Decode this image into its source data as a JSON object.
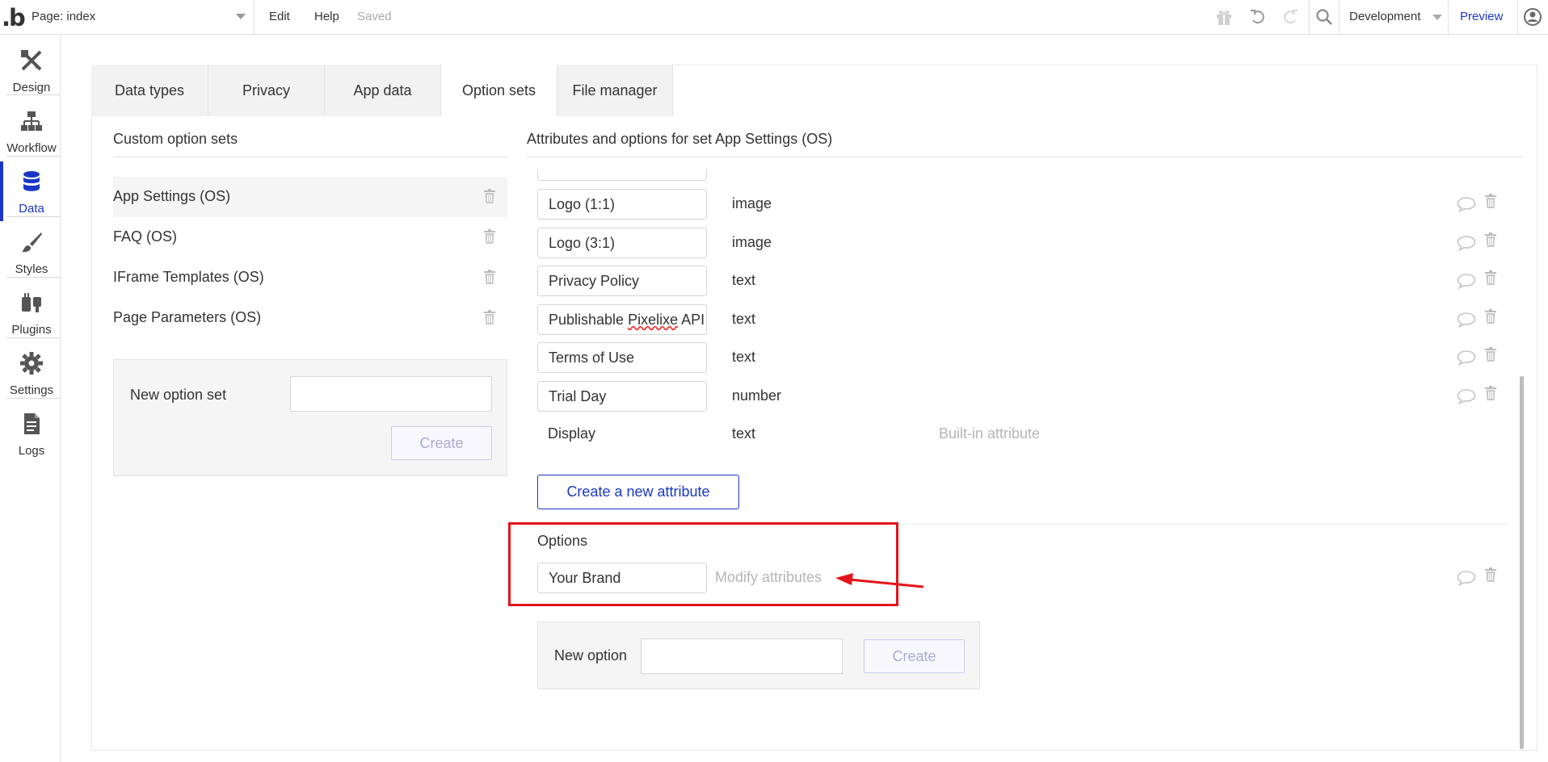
{
  "topbar": {
    "page_label": "Page: index",
    "menu_edit": "Edit",
    "menu_help": "Help",
    "status": "Saved",
    "environment": "Development",
    "preview": "Preview"
  },
  "sidebar": {
    "items": [
      {
        "label": "Design",
        "icon": "design-icon"
      },
      {
        "label": "Workflow",
        "icon": "workflow-icon"
      },
      {
        "label": "Data",
        "icon": "database-icon"
      },
      {
        "label": "Styles",
        "icon": "brush-icon"
      },
      {
        "label": "Plugins",
        "icon": "plug-icon"
      },
      {
        "label": "Settings",
        "icon": "gear-icon"
      },
      {
        "label": "Logs",
        "icon": "document-icon"
      }
    ],
    "active": "Data"
  },
  "tabs": [
    {
      "label": "Data types"
    },
    {
      "label": "Privacy"
    },
    {
      "label": "App data"
    },
    {
      "label": "Option sets"
    },
    {
      "label": "File manager"
    }
  ],
  "custom_sets": {
    "title": "Custom option sets",
    "items": [
      {
        "name": "App Settings (OS)"
      },
      {
        "name": "FAQ (OS)"
      },
      {
        "name": "IFrame Templates (OS)"
      },
      {
        "name": "Page Parameters (OS)"
      }
    ],
    "new_label": "New option set",
    "create_label": "Create"
  },
  "attributes": {
    "title": "Attributes and options for set App Settings (OS)",
    "rows": [
      {
        "name": "Logo (1:1)",
        "type": "image"
      },
      {
        "name": "Logo (3:1)",
        "type": "image"
      },
      {
        "name": "Privacy Policy",
        "type": "text"
      },
      {
        "name": "Publishable Pixelixe API",
        "type": "text"
      },
      {
        "name": "Terms of Use",
        "type": "text"
      },
      {
        "name": "Trial Day",
        "type": "number"
      }
    ],
    "builtin": {
      "name": "Display",
      "type": "text",
      "note": "Built-in attribute"
    },
    "create_button": "Create a new attribute"
  },
  "options": {
    "title": "Options",
    "items": [
      {
        "name": "Your Brand",
        "action": "Modify attributes"
      }
    ],
    "new_label": "New option",
    "create_label": "Create"
  },
  "colors": {
    "accent": "#1a37c8",
    "annotation": "#e4141b"
  }
}
